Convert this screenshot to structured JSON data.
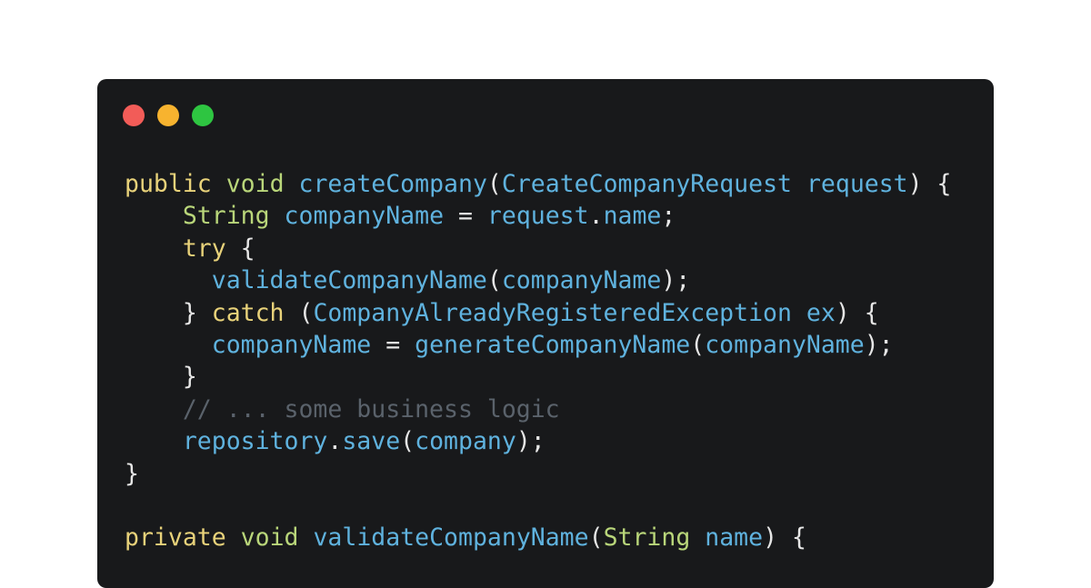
{
  "window": {
    "dots": [
      {
        "name": "close",
        "color": "#f25c58"
      },
      {
        "name": "minimize",
        "color": "#f7b32f"
      },
      {
        "name": "maximize",
        "color": "#2ec541"
      }
    ],
    "colors": {
      "background": "#18191b",
      "keyword": "#e8d27a",
      "type": "#b9d67a",
      "identifier": "#5fb2de",
      "punctuation": "#e6e6e6",
      "comment": "#5a626b"
    }
  },
  "code": {
    "lines": [
      [
        {
          "t": "public",
          "c": "kw"
        },
        {
          "t": " ",
          "c": "pn"
        },
        {
          "t": "void",
          "c": "ty"
        },
        {
          "t": " ",
          "c": "pn"
        },
        {
          "t": "createCompany",
          "c": "id"
        },
        {
          "t": "(",
          "c": "pn"
        },
        {
          "t": "CreateCompanyRequest",
          "c": "id"
        },
        {
          "t": " ",
          "c": "pn"
        },
        {
          "t": "request",
          "c": "id"
        },
        {
          "t": ") {",
          "c": "pn"
        }
      ],
      [
        {
          "t": "    ",
          "c": "pn"
        },
        {
          "t": "String",
          "c": "ty"
        },
        {
          "t": " ",
          "c": "pn"
        },
        {
          "t": "companyName",
          "c": "id"
        },
        {
          "t": " = ",
          "c": "pn"
        },
        {
          "t": "request",
          "c": "id"
        },
        {
          "t": ".",
          "c": "pn"
        },
        {
          "t": "name",
          "c": "id"
        },
        {
          "t": ";",
          "c": "pn"
        }
      ],
      [
        {
          "t": "    ",
          "c": "pn"
        },
        {
          "t": "try",
          "c": "kw"
        },
        {
          "t": " {",
          "c": "pn"
        }
      ],
      [
        {
          "t": "      ",
          "c": "pn"
        },
        {
          "t": "validateCompanyName",
          "c": "id"
        },
        {
          "t": "(",
          "c": "pn"
        },
        {
          "t": "companyName",
          "c": "id"
        },
        {
          "t": ");",
          "c": "pn"
        }
      ],
      [
        {
          "t": "    } ",
          "c": "pn"
        },
        {
          "t": "catch",
          "c": "kw"
        },
        {
          "t": " (",
          "c": "pn"
        },
        {
          "t": "CompanyAlreadyRegisteredException",
          "c": "id"
        },
        {
          "t": " ",
          "c": "pn"
        },
        {
          "t": "ex",
          "c": "id"
        },
        {
          "t": ") {",
          "c": "pn"
        }
      ],
      [
        {
          "t": "      ",
          "c": "pn"
        },
        {
          "t": "companyName",
          "c": "id"
        },
        {
          "t": " = ",
          "c": "pn"
        },
        {
          "t": "generateCompanyName",
          "c": "id"
        },
        {
          "t": "(",
          "c": "pn"
        },
        {
          "t": "companyName",
          "c": "id"
        },
        {
          "t": ");",
          "c": "pn"
        }
      ],
      [
        {
          "t": "    }",
          "c": "pn"
        }
      ],
      [
        {
          "t": "    ",
          "c": "pn"
        },
        {
          "t": "// ... some business logic",
          "c": "cm"
        }
      ],
      [
        {
          "t": "    ",
          "c": "pn"
        },
        {
          "t": "repository",
          "c": "id"
        },
        {
          "t": ".",
          "c": "pn"
        },
        {
          "t": "save",
          "c": "id"
        },
        {
          "t": "(",
          "c": "pn"
        },
        {
          "t": "company",
          "c": "id"
        },
        {
          "t": ");",
          "c": "pn"
        }
      ],
      [
        {
          "t": "}",
          "c": "pn"
        }
      ],
      [],
      [
        {
          "t": "private",
          "c": "kw"
        },
        {
          "t": " ",
          "c": "pn"
        },
        {
          "t": "void",
          "c": "ty"
        },
        {
          "t": " ",
          "c": "pn"
        },
        {
          "t": "validateCompanyName",
          "c": "id"
        },
        {
          "t": "(",
          "c": "pn"
        },
        {
          "t": "String",
          "c": "ty"
        },
        {
          "t": " ",
          "c": "pn"
        },
        {
          "t": "name",
          "c": "id"
        },
        {
          "t": ") {",
          "c": "pn"
        }
      ]
    ]
  }
}
